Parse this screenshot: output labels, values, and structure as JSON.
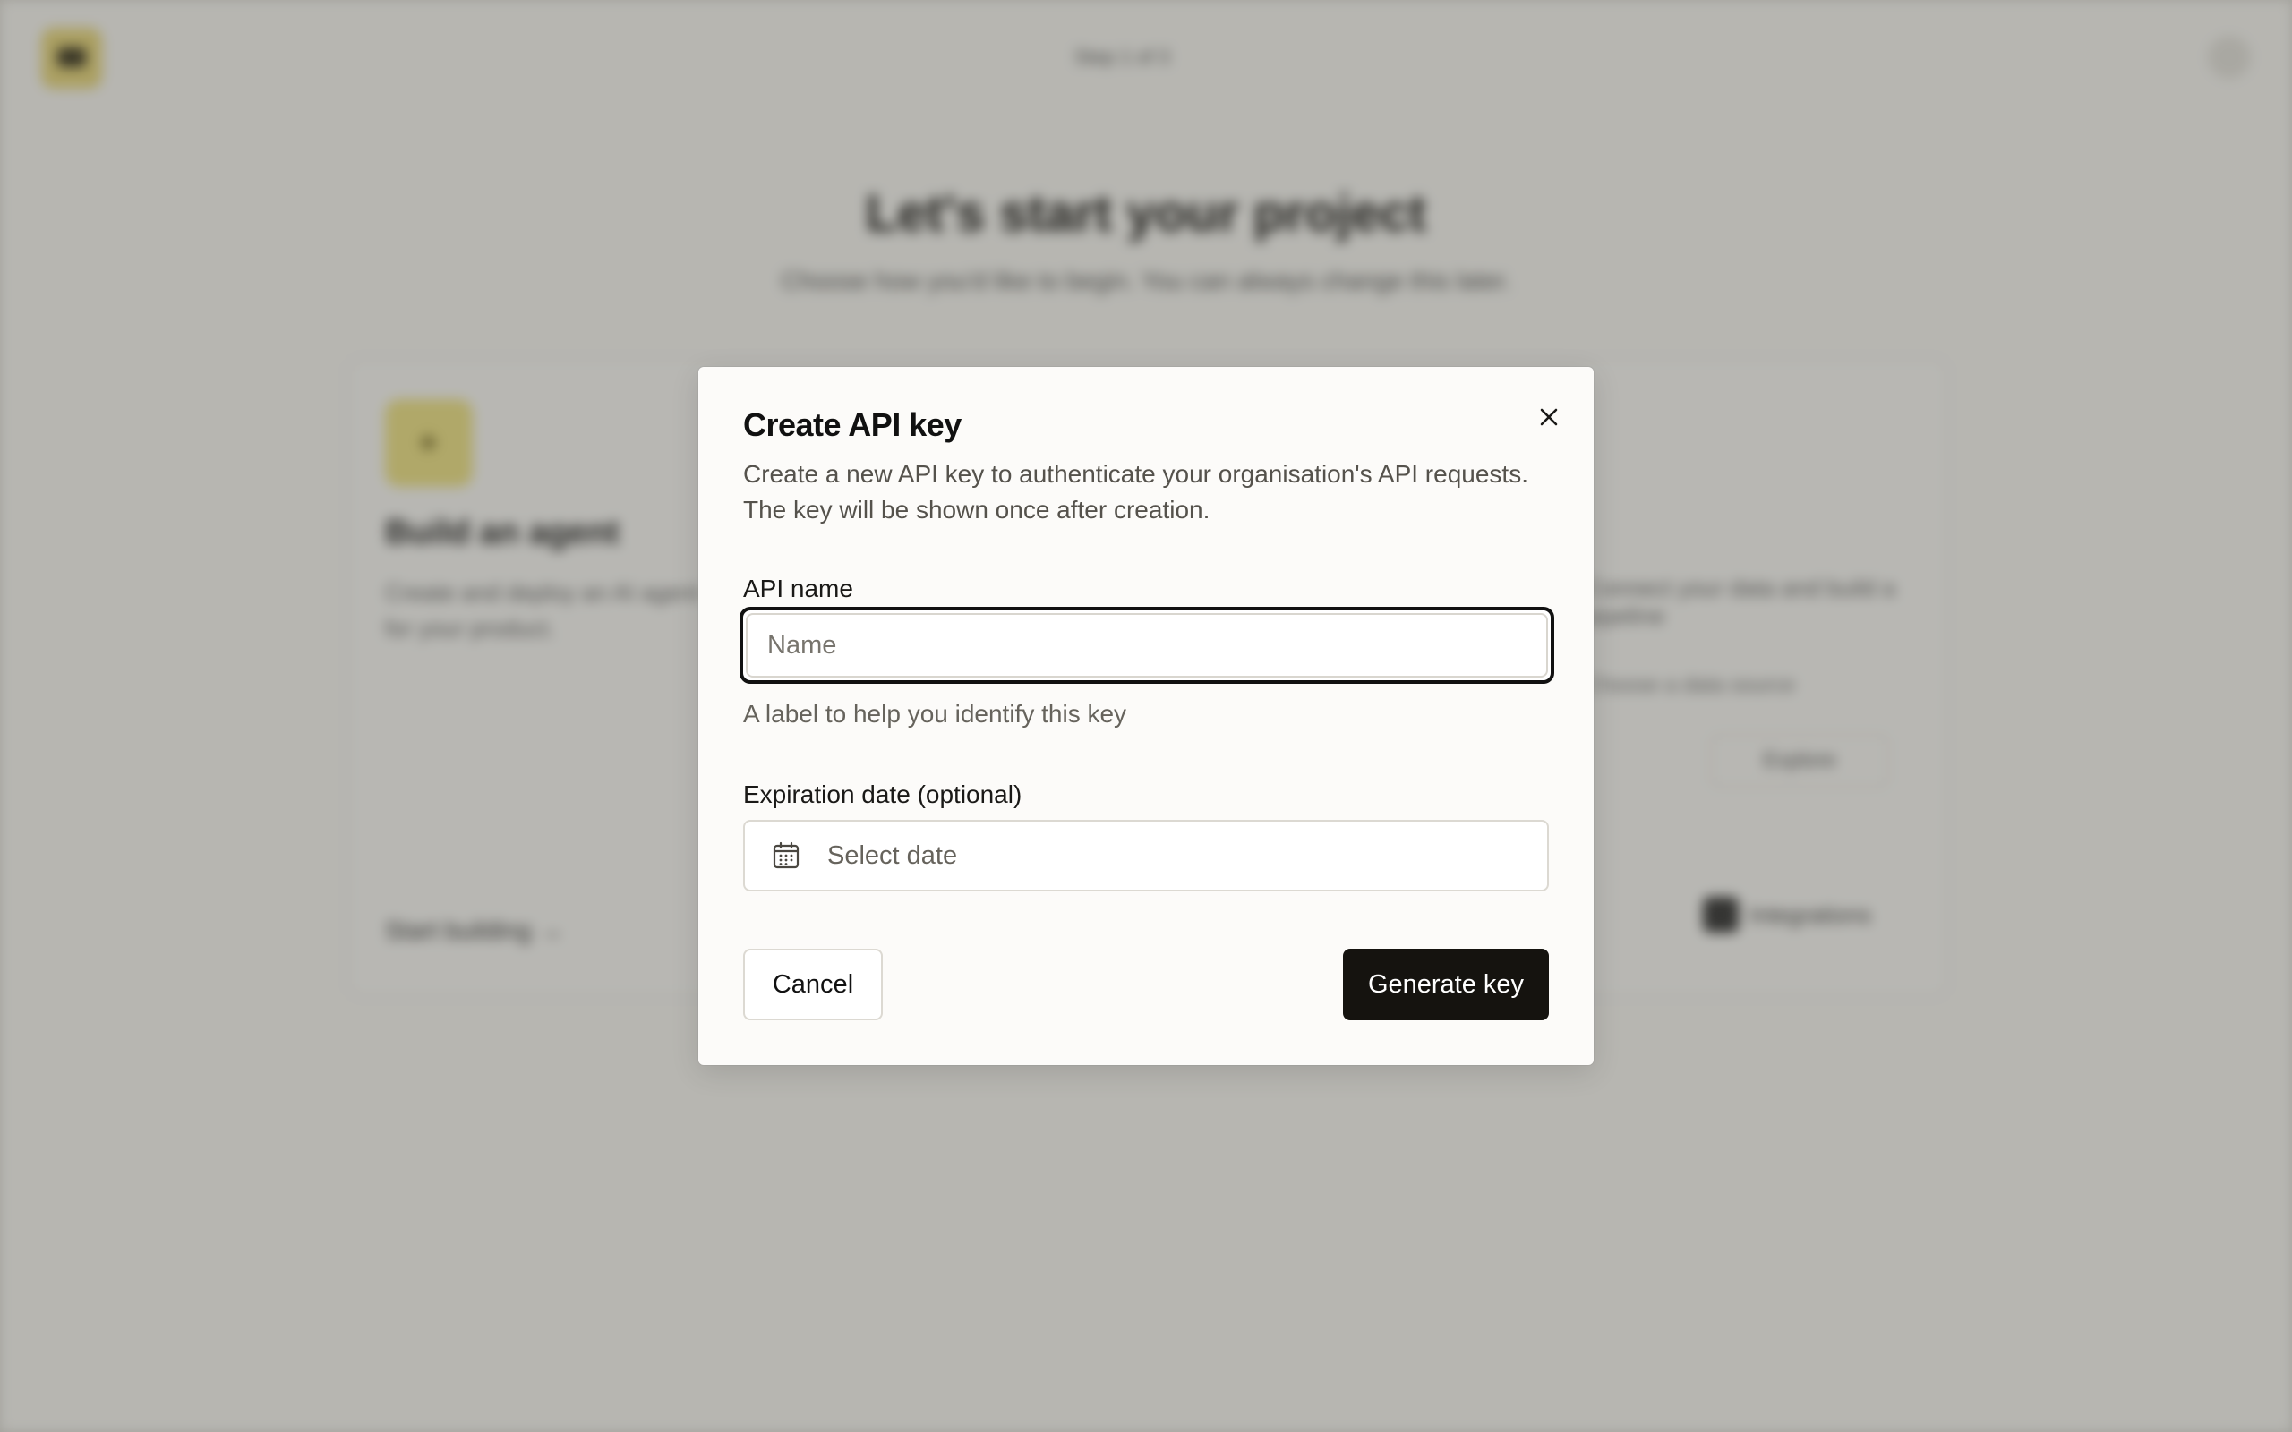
{
  "background": {
    "nav_text": "Step 1 of 3",
    "title": "Let's start your project",
    "subtitle": "Choose how you'd like to begin. You can always change this later.",
    "card": {
      "heading": "Build an agent",
      "text": "Create and deploy an AI agent for your product.",
      "link": "Start building →",
      "right_text": "Connect your data and build a pipeline",
      "right_sub": "Choose a data source",
      "pill": "Explore",
      "button": "Integrations"
    }
  },
  "modal": {
    "title": "Create API key",
    "description": "Create a new API key to authenticate your organisation's API requests. The key will be shown once after creation.",
    "name_label": "API name",
    "name_placeholder": "Name",
    "name_value": "",
    "name_helper": "A label to help you identify this key",
    "expiry_label": "Expiration date (optional)",
    "expiry_placeholder": "Select date",
    "cancel_label": "Cancel",
    "generate_label": "Generate key",
    "close_icon": "close-icon",
    "calendar_icon": "calendar-icon"
  },
  "colors": {
    "primary_button": "#15130f",
    "focus_ring": "#111111",
    "brand_yellow": "#ede184"
  }
}
